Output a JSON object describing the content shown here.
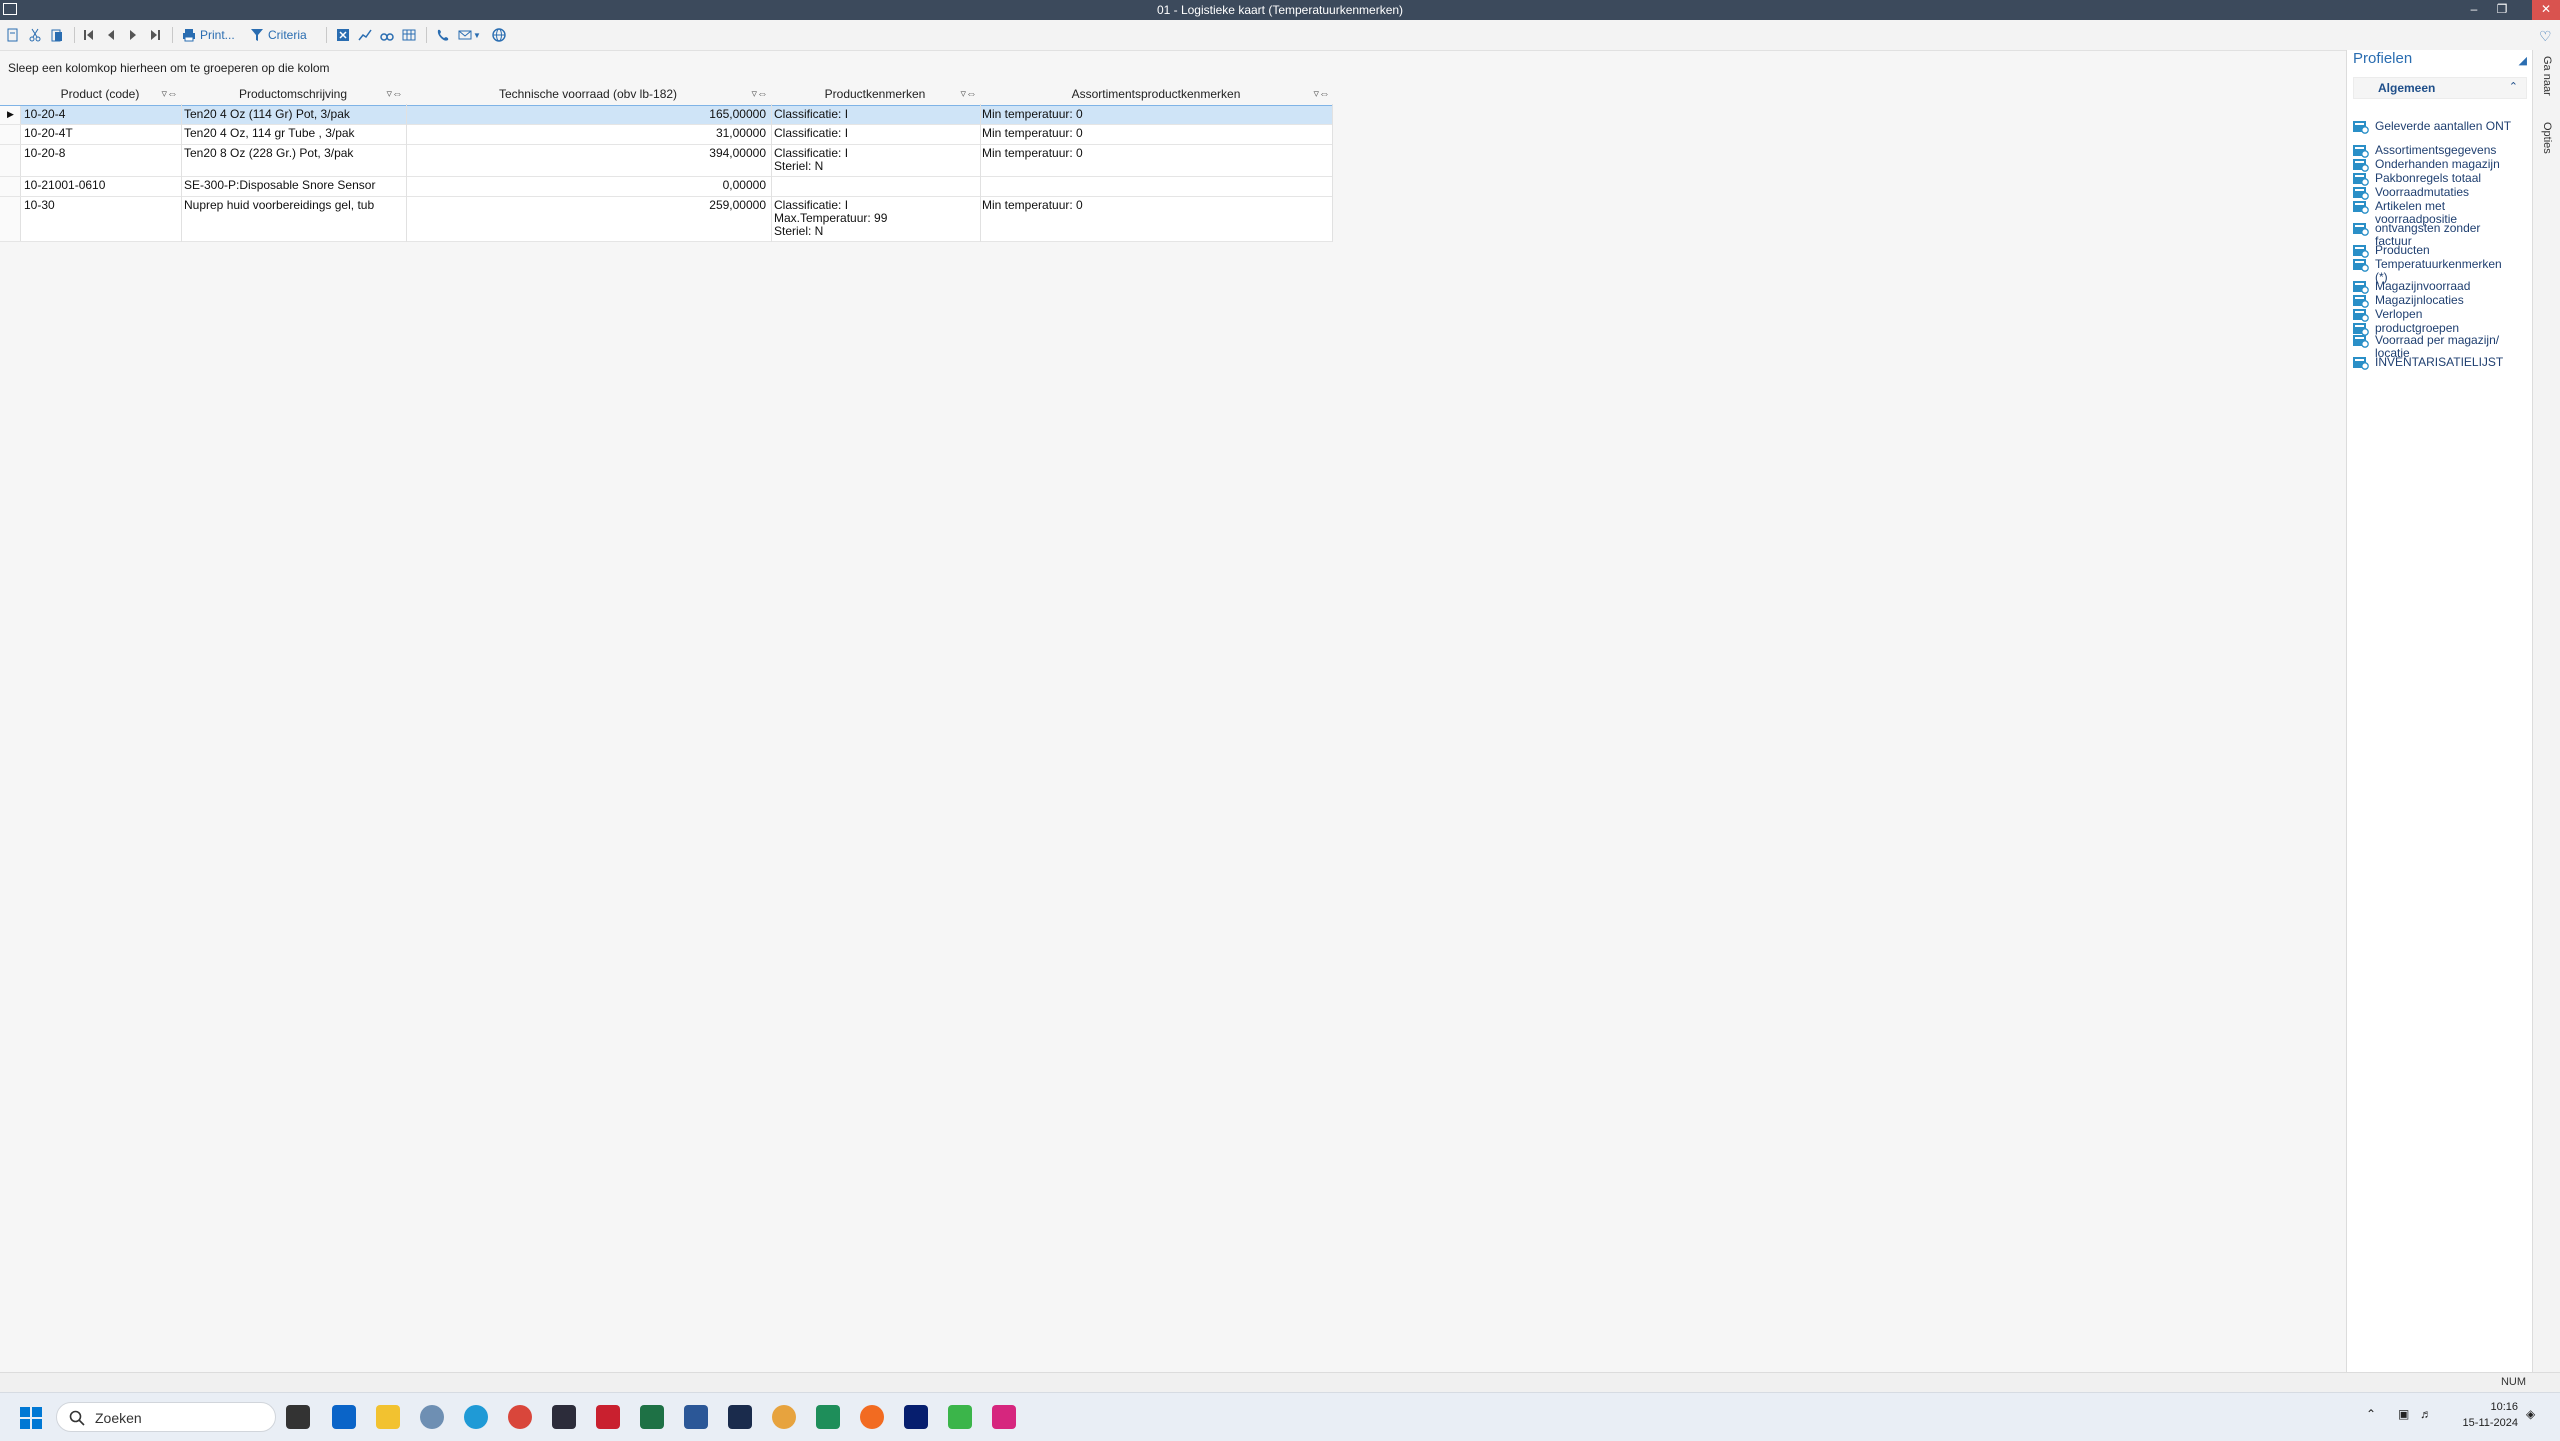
{
  "window": {
    "title": "01 - Logistieke kaart (Temperatuurkenmerken)"
  },
  "toolbar": {
    "print_label": "Print...",
    "criteria_label": "Criteria"
  },
  "grid": {
    "group_hint": "Sleep een kolomkop hierheen om te groeperen op die kolom",
    "columns": [
      "Product (code)",
      "Productomschrijving",
      "Technische voorraad (obv lb-182)",
      "Productkenmerken",
      "Assortimentsproductkenmerken"
    ],
    "rows": [
      {
        "code": "10-20-4",
        "desc": "Ten20 4 Oz (114 Gr) Pot, 3/pak",
        "stock": "165,00000",
        "kenmerken": "Classificatie: I",
        "assort": "Min temperatuur: 0"
      },
      {
        "code": "10-20-4T",
        "desc": "Ten20 4 Oz, 114 gr Tube , 3/pak",
        "stock": "31,00000",
        "kenmerken": "Classificatie: I",
        "assort": "Min temperatuur: 0"
      },
      {
        "code": "10-20-8",
        "desc": "Ten20 8 Oz (228 Gr.) Pot, 3/pak",
        "stock": "394,00000",
        "kenmerken": "Classificatie: I\nSteriel: N",
        "assort": "Min temperatuur: 0"
      },
      {
        "code": "10-21001-0610",
        "desc": "SE-300-P:Disposable Snore Sensor",
        "stock": "0,00000",
        "kenmerken": "",
        "assort": ""
      },
      {
        "code": "10-30",
        "desc": "Nuprep huid voorbereidings gel, tub",
        "stock": "259,00000",
        "kenmerken": "Classificatie: I\nMax.Temperatuur: 99\nSteriel: N",
        "assort": "Min temperatuur: 0"
      }
    ]
  },
  "profiles": {
    "title": "Profielen",
    "group_label": "Algemeen",
    "items": [
      "Geleverde aantallen ONT",
      "Assortimentsgegevens",
      "Onderhanden magazijn",
      "Pakbonregels totaal",
      "Voorraadmutaties",
      "Artikelen met\nvoorraadpositie",
      "ontvangsten zonder\nfactuur",
      "Producten",
      "Temperatuurkenmerken\n(*)",
      "Magazijnvoorraad",
      "Magazijnlocaties",
      "Verlopen",
      "productgroepen",
      "Voorraad per magazijn/\nlocatie",
      "INVENTARISATIELIJST"
    ]
  },
  "side_tabs": {
    "goto": "Ga naar",
    "options": "Opties"
  },
  "statusbar": {
    "num": "NUM"
  },
  "taskbar": {
    "search_placeholder": "Zoeken",
    "time": "10:16",
    "date": "15-11-2024"
  },
  "colors": {
    "accent": "#2a6db1",
    "titlebar": "#3c4a5c",
    "selection": "#cfe4f7"
  }
}
